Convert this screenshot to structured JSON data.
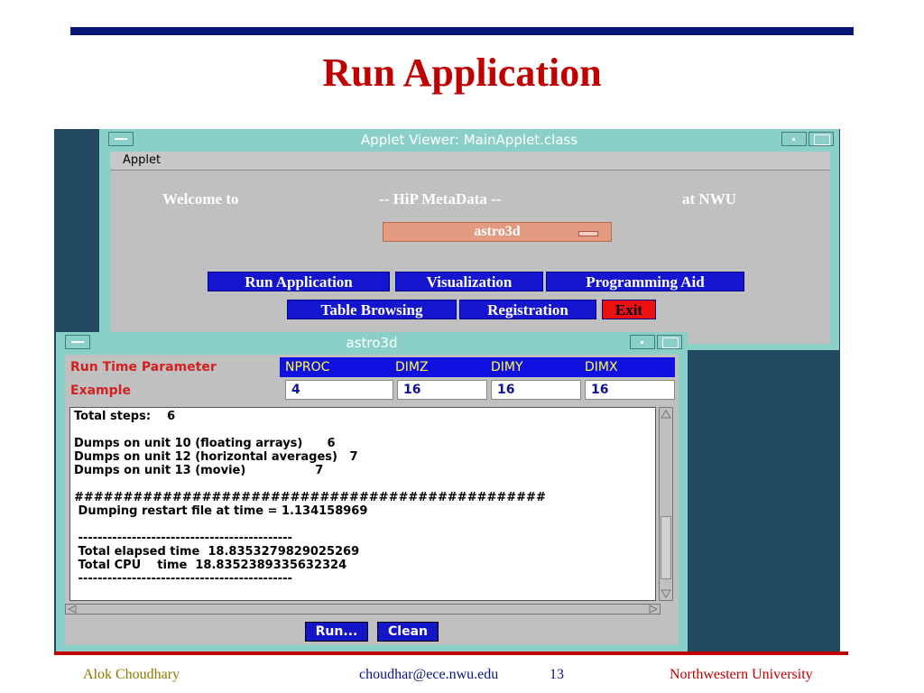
{
  "slide": {
    "title": "Run Application",
    "footer_left": "Alok Choudhary",
    "footer_center": "choudhar@ece.nwu.edu",
    "page_number": "13",
    "footer_right": "Northwestern University"
  },
  "main_window": {
    "title": "Applet Viewer: MainApplet.class",
    "menu": "Applet",
    "welcome_left": "Welcome to",
    "welcome_center": "-- HiP MetaData --",
    "welcome_right": "at NWU",
    "selected_app": "astro3d",
    "buttons": {
      "run_application": "Run Application",
      "visualization": "Visualization",
      "programming_aid": "Programming Aid",
      "table_browsing": "Table Browsing",
      "registration": "Registration",
      "exit": "Exit"
    }
  },
  "sub_window": {
    "title": "astro3d",
    "param_label": "Run Time Parameter",
    "example_label": "Example",
    "headers": [
      "NPROC",
      "DIMZ",
      "DIMY",
      "DIMX"
    ],
    "values": [
      "4",
      "16",
      "16",
      "16"
    ],
    "output": "Total steps:    6\n\nDumps on unit 10 (floating arrays)      6\nDumps on unit 12 (horizontal averages)   7\nDumps on unit 13 (movie)                 7\n\n################################################\n Dumping restart file at time = 1.134158969\n\n --------------------------------------------\n Total elapsed time  18.8353279829025269\n Total CPU    time  18.8352389335632324\n --------------------------------------------",
    "run_button": "Run...",
    "clean_button": "Clean"
  },
  "colors": {
    "title_red": "#c00000",
    "bar_navy": "#0a1577",
    "window_teal": "#8ad0c8",
    "button_blue": "#1515d0"
  }
}
